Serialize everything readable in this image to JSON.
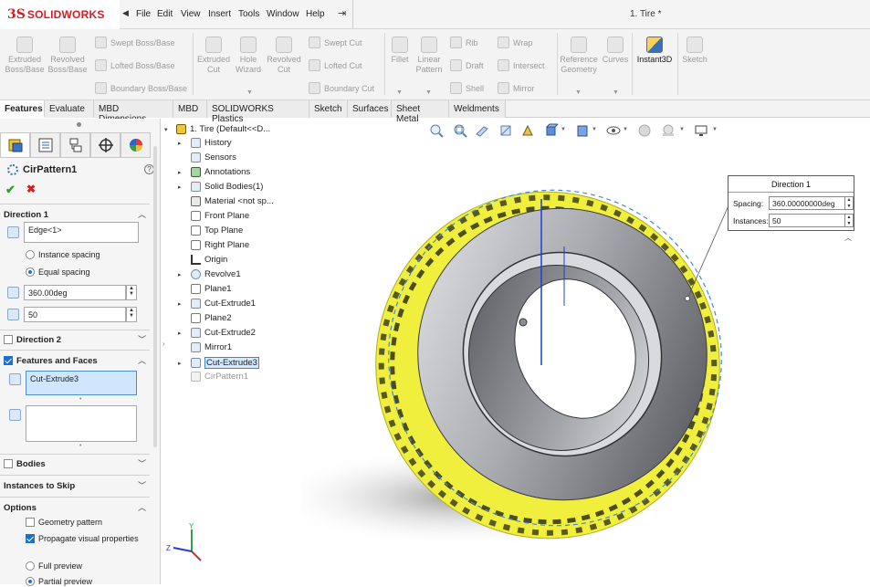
{
  "app": {
    "logo_ds": "3S",
    "logo_name": "SOLIDWORKS",
    "document_title": "1. Tire *"
  },
  "menu": {
    "items": [
      "File",
      "Edit",
      "View",
      "Insert",
      "Tools",
      "Window",
      "Help"
    ]
  },
  "command_manager": {
    "extruded_boss": "Extruded Boss/Base",
    "revolved_boss": "Revolved Boss/Base",
    "swept_boss": "Swept Boss/Base",
    "lofted_boss": "Lofted Boss/Base",
    "boundary_boss": "Boundary Boss/Base",
    "extruded_cut": "Extruded Cut",
    "hole_wizard": "Hole Wizard",
    "revolved_cut": "Revolved Cut",
    "swept_cut": "Swept Cut",
    "lofted_cut": "Lofted Cut",
    "boundary_cut": "Boundary Cut",
    "fillet": "Fillet",
    "linear_pattern": "Linear Pattern",
    "rib": "Rib",
    "draft": "Draft",
    "shell": "Shell",
    "wrap": "Wrap",
    "intersect": "Intersect",
    "mirror": "Mirror",
    "reference_geometry": "Reference Geometry",
    "curves": "Curves",
    "instant3d": "Instant3D",
    "sketch": "Sketch"
  },
  "tabs": [
    "Features",
    "Evaluate",
    "MBD Dimensions",
    "MBD",
    "SOLIDWORKS Plastics",
    "Sketch",
    "Surfaces",
    "Sheet Metal",
    "Weldments"
  ],
  "property_manager": {
    "title": "CirPattern1",
    "direction1": {
      "label": "Direction 1",
      "edge_value": "Edge<1>",
      "instance_spacing": "Instance spacing",
      "equal_spacing": "Equal spacing",
      "angle": "360.00deg",
      "instances": "50"
    },
    "direction2": {
      "label": "Direction 2"
    },
    "features_faces": {
      "label": "Features and Faces",
      "feature_item": "Cut-Extrude3"
    },
    "bodies": {
      "label": "Bodies"
    },
    "instances_to_skip": {
      "label": "Instances to Skip"
    },
    "options": {
      "label": "Options",
      "geometry_pattern": "Geometry pattern",
      "propagate_visual": "Propagate visual properties",
      "full_preview": "Full preview",
      "partial_preview": "Partial preview"
    }
  },
  "feature_tree": {
    "root": "1. Tire  (Default<<D...",
    "items": [
      "History",
      "Sensors",
      "Annotations",
      "Solid Bodies(1)",
      "Material <not sp...",
      "Front Plane",
      "Top Plane",
      "Right Plane",
      "Origin",
      "Revolve1",
      "Plane1",
      "Cut-Extrude1",
      "Plane2",
      "Cut-Extrude2",
      "Mirror1",
      "Cut-Extrude3",
      "CirPattern1"
    ]
  },
  "callout": {
    "title": "Direction 1",
    "spacing_label": "Spacing:",
    "spacing_value": "360.00000000deg",
    "instances_label": "Instances:",
    "instances_value": "50"
  },
  "triad": {
    "y": "Y",
    "z": "Z"
  },
  "colors": {
    "brand": "#d21f26",
    "highlight": "#f2f21a",
    "selection": "#3a86d8",
    "tire_body": "#8c8e93"
  }
}
